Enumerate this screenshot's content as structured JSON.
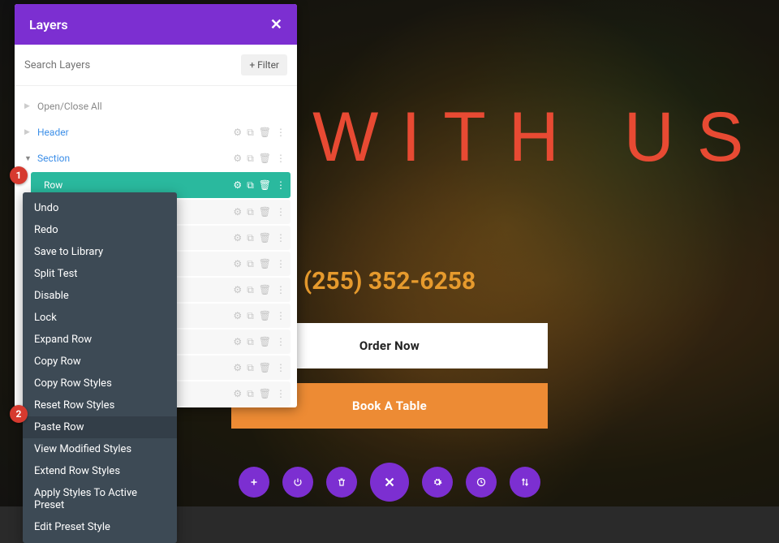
{
  "hero": {
    "title": "DINE WITH US",
    "phone": "(255) 352-6258",
    "order_btn": "Order Now",
    "book_btn": "Book A Table"
  },
  "panel": {
    "title": "Layers",
    "search_placeholder": "Search Layers",
    "filter_label": "+ Filter",
    "open_close": "Open/Close All",
    "items": {
      "header": "Header",
      "section": "Section",
      "row": "Row"
    }
  },
  "context_menu": [
    "Undo",
    "Redo",
    "Save to Library",
    "Split Test",
    "Disable",
    "Lock",
    "Expand Row",
    "Copy Row",
    "Copy Row Styles",
    "Reset Row Styles",
    "Paste Row",
    "View Modified Styles",
    "Extend Row Styles",
    "Apply Styles To Active Preset",
    "Edit Preset Style"
  ],
  "badges": {
    "one": "1",
    "two": "2"
  },
  "toolbar_icons": [
    "plus",
    "power",
    "trash",
    "close",
    "gear",
    "clock",
    "arrows"
  ]
}
